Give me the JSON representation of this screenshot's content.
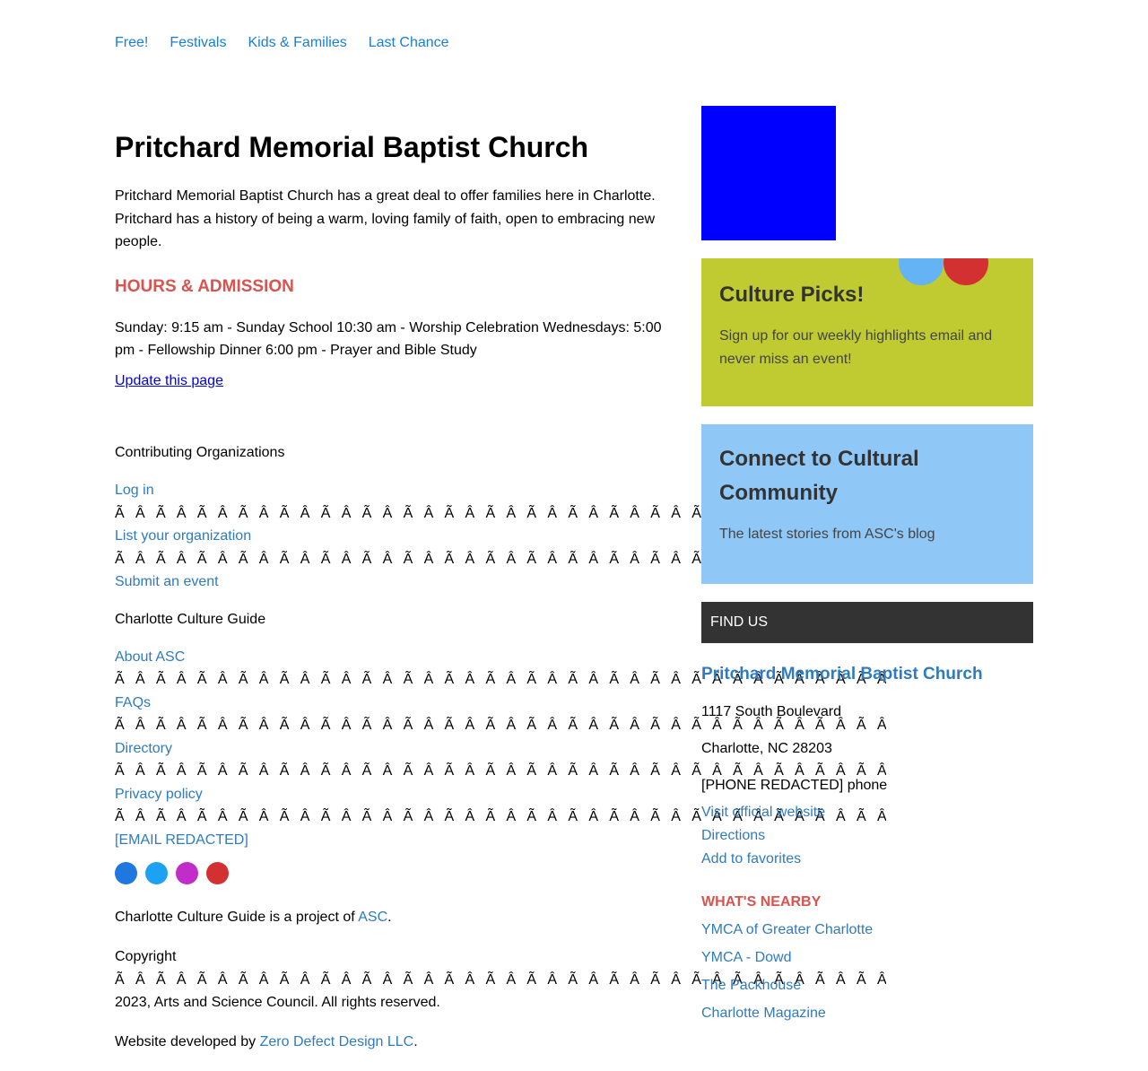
{
  "nav": [
    "Free!",
    "Festivals",
    "Kids & Families",
    "Last Chance"
  ],
  "page": {
    "title": "Pritchard Memorial Baptist Church",
    "intro": "Pritchard Memorial Baptist Church has a great deal to offer families here in Charlotte. Pritchard has a history of being a warm, loving family of faith, open to embracing new people.",
    "hours_heading": "HOURS & ADMISSION",
    "hours": "Sunday: 9:15 am - Sunday School 10:30 am - Worship Celebration Wednesdays: 5:00 pm - Fellowship Dinner 6:00 pm - Prayer and Bible Study",
    "update_link": "Update this page"
  },
  "footer": {
    "contributing_heading": "Contributing Organizations",
    "contributing_links": [
      "Log in",
      "List your organization",
      "Submit an event"
    ],
    "guide_heading": "Charlotte Culture Guide",
    "guide_links": [
      "About ASC",
      "FAQs",
      "Directory",
      "Privacy policy",
      "[EMAIL REDACTED]"
    ],
    "garble_short": "ÃÂÃÂÃÂÃÂÃÂÃÂÃÂÃÂÃÂÃÂÃÂÃÂÃÂÃÂÃÂÃÂÃÂÃÂÃÂÃÂÃÂÃÂÃÂÃÂÃÂÃÂÃÂÃÂÃÂÃÂ",
    "garble_long": "ÃÂÃÂÃÂÃÂÃÂÃÂÃÂÃÂÃÂÃÂÃÂÃÂÃÂÃÂÃÂÃÂÃÂÃÂÃÂÃÂÃÂÃÂÃÂÃÂÃÂÃÂÃÂÃÂÃÂÃÂÃÂÃÂÃÂ",
    "garble_dot": "ÃÂÃÂÃÂÃÂÃÂÃÂÃÂÃÂÃÂÃÂÃÂÃÂÃÂÃÂÃÂÃÂÃÂÃÂÃÂÃÂÃÂÃÂÃÂÃÂÃÂÃÂÃÂÃÂÃÂÃÂÃÂÃÂÃÂ·",
    "social_colors": [
      "#1f77e0",
      "#1da1f2",
      "#c22dc9",
      "#d33131"
    ],
    "social_icons": [
      "facebook-icon",
      "twitter-icon",
      "instagram-icon",
      "youtube-icon"
    ],
    "project_prefix": "Charlotte Culture Guide is a project of ",
    "project_link": "ASC",
    "project_suffix": ".",
    "copyright_label": "Copyright",
    "copyright_garble": "ÃÂÃÂÃÂÃÂÃÂÃÂÃÂÃÂÃÂÃÂÃÂÃÂÃÂÃÂÃÂÃÂÃÂÃÂÃÂÃÂÃÂÃÂÃÂÃÂÃÂÃÂÃÂÃÂÃÂÃÂÃÂÃÂÃÂ©",
    "copyright_text": "2023, Arts and Science Council. All rights reserved.",
    "dev_prefix": "Website developed by ",
    "dev_link": "Zero Defect Design LLC",
    "dev_suffix": "."
  },
  "sidebar": {
    "picks_title": "Culture Picks!",
    "picks_text": "Sign up for our weekly highlights email and never miss an event!",
    "connect_title": "Connect to Cultural Community",
    "connect_text": "The latest stories from ASC's blog",
    "find_us": "FIND US",
    "place_name": "Pritchard Memorial Baptist Church",
    "address_line1": "1117 South Boulevard",
    "address_line2": "Charlotte, NC 28203",
    "phone": "[PHONE REDACTED] phone",
    "links": [
      "Visit official website",
      "Directions",
      "Add to favorites"
    ],
    "nearby_heading": "WHAT'S NEARBY",
    "nearby": [
      "YMCA of Greater Charlotte",
      "YMCA - Dowd",
      "The Packhouse",
      "Charlotte Magazine"
    ]
  },
  "colors": {
    "nav_link": "#1a7fd4",
    "link": "#2f7bbd",
    "accent_red": "#d9534f",
    "picks_bg": "#c0cb31",
    "connect_bg": "#8fc8f7",
    "find_us_bg": "#333333",
    "ad_blue": "#0000ff"
  }
}
